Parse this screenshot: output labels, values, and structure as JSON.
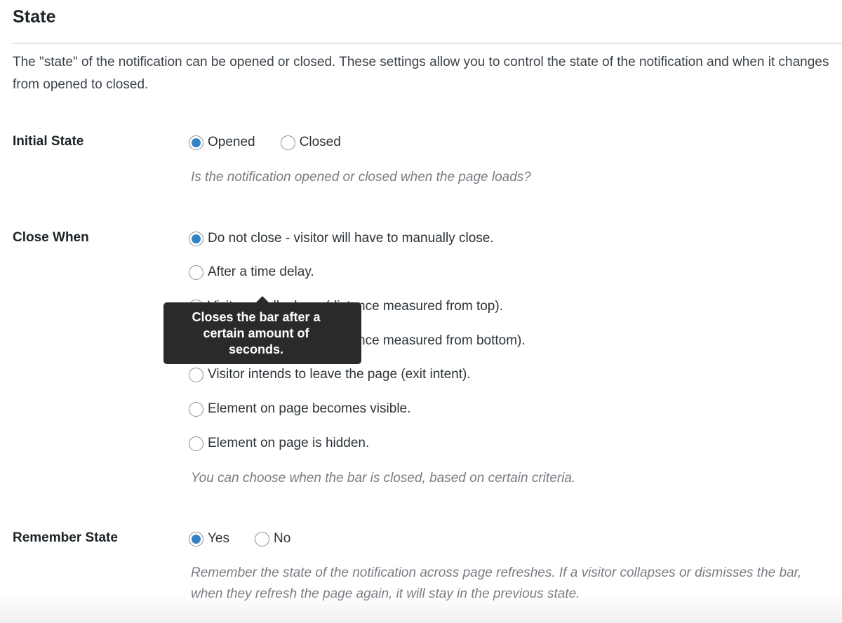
{
  "section": {
    "title": "State",
    "intro": "The \"state\" of the notification can be opened or closed. These settings allow you to control the state of the notification and when it changes from opened to closed."
  },
  "initial_state": {
    "label": "Initial State",
    "options": [
      {
        "label": "Opened",
        "checked": true
      },
      {
        "label": "Closed",
        "checked": false
      }
    ],
    "help": "Is the notification opened or closed when the page loads?"
  },
  "close_when": {
    "label": "Close When",
    "options": [
      {
        "label": "Do not close - visitor will have to manually close.",
        "checked": true
      },
      {
        "label": "After a time delay.",
        "checked": false
      },
      {
        "label": "Visitor scrolls down (distance measured from top).",
        "checked": false
      },
      {
        "label": "Visitor scrolls down (distance measured from bottom).",
        "checked": false
      },
      {
        "label": "Visitor intends to leave the page (exit intent).",
        "checked": false
      },
      {
        "label": "Element on page becomes visible.",
        "checked": false
      },
      {
        "label": "Element on page is hidden.",
        "checked": false
      }
    ],
    "help": "You can choose when the bar is closed, based on certain criteria."
  },
  "tooltip": {
    "text": "Closes the bar after a certain amount of seconds."
  },
  "remember_state": {
    "label": "Remember State",
    "options": [
      {
        "label": "Yes",
        "checked": true
      },
      {
        "label": "No",
        "checked": false
      }
    ],
    "help": "Remember the state of the notification across page refreshes. If a visitor collapses or dismisses the bar, when they refresh the page again, it will stay in the previous state."
  },
  "colors": {
    "accent": "#3582c4",
    "tooltip_bg": "#2a2a2a",
    "help_text": "#787c82"
  }
}
